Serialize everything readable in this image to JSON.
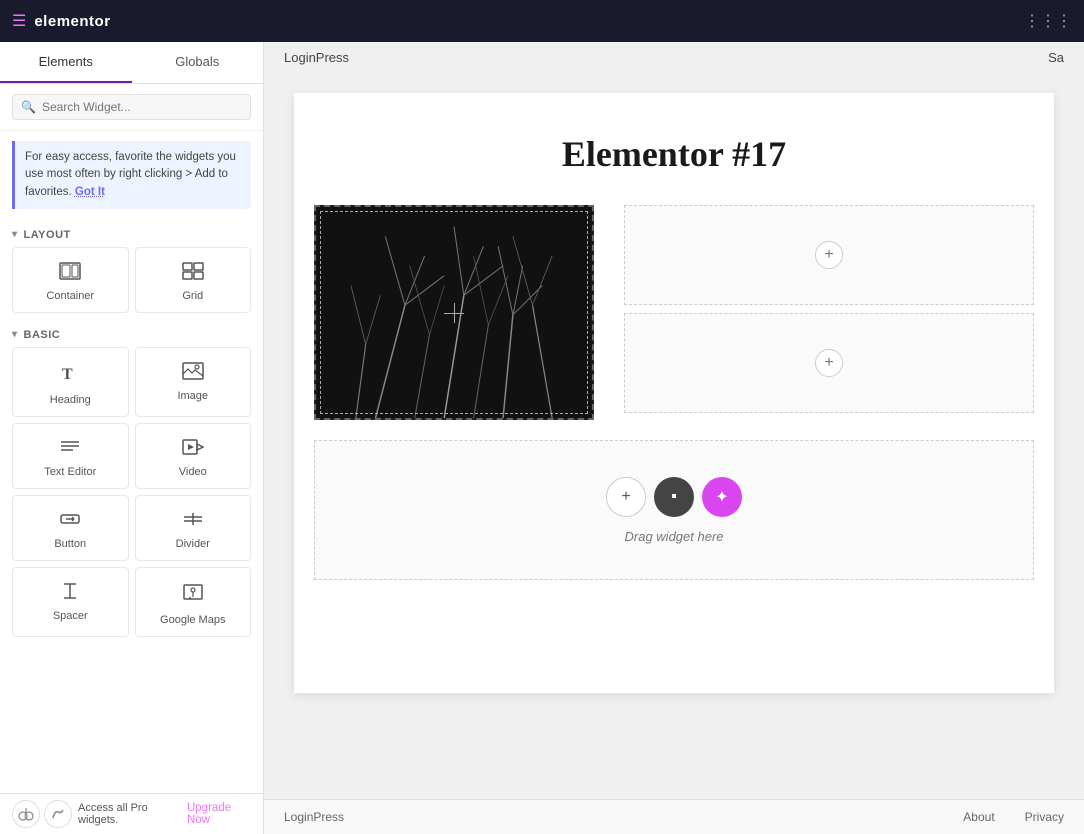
{
  "topbar": {
    "logo": "elementor",
    "page_name": "LoginPress",
    "user_label": "Sa"
  },
  "sidebar": {
    "tabs": [
      {
        "label": "Elements",
        "active": true
      },
      {
        "label": "Globals",
        "active": false
      }
    ],
    "search_placeholder": "Search Widget...",
    "tip_text": "For easy access, favorite the widgets you use most often by right clicking > Add to favorites.",
    "tip_cta": "Got It",
    "sections": [
      {
        "label": "Layout",
        "widgets": [
          {
            "icon": "container",
            "label": "Container"
          },
          {
            "icon": "grid",
            "label": "Grid"
          }
        ]
      },
      {
        "label": "Basic",
        "widgets": [
          {
            "icon": "heading",
            "label": "Heading"
          },
          {
            "icon": "image",
            "label": "Image"
          },
          {
            "icon": "text-editor",
            "label": "Text Editor"
          },
          {
            "icon": "video",
            "label": "Video"
          },
          {
            "icon": "button",
            "label": "Button"
          },
          {
            "icon": "divider",
            "label": "Divider"
          },
          {
            "icon": "spacer",
            "label": "Spacer"
          },
          {
            "icon": "google-maps",
            "label": "Google Maps"
          }
        ]
      }
    ],
    "bottom_text": "Access all Pro widgets.",
    "upgrade_label": "Upgrade Now"
  },
  "canvas": {
    "page_title": "Elementor #17",
    "drop_zone_text": "Drag widget here",
    "add_button": "+",
    "folder_button": "▪",
    "magic_button": "✦"
  },
  "footer": {
    "brand": "LoginPress",
    "nav_items": [
      "About",
      "Privacy"
    ]
  }
}
